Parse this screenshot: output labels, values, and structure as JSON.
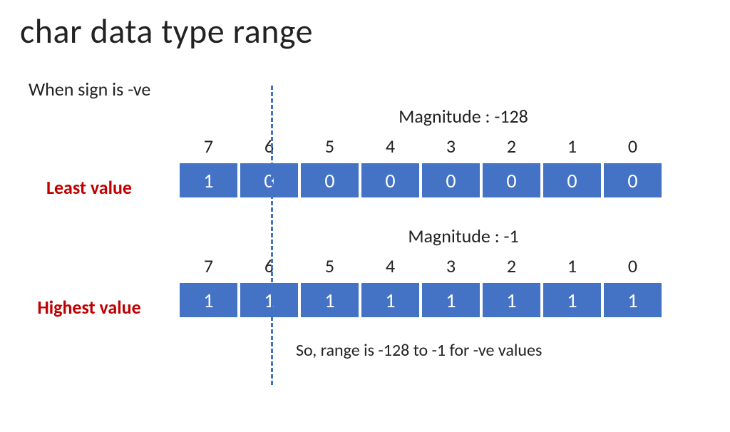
{
  "title": "char data type range",
  "subtitle": "When sign is -ve",
  "sections": [
    {
      "magnitude": "Magnitude  : -128",
      "label": "Least value",
      "indices": [
        "7",
        "6",
        "5",
        "4",
        "3",
        "2",
        "1",
        "0"
      ],
      "bits": [
        "1",
        "0",
        "0",
        "0",
        "0",
        "0",
        "0",
        "0"
      ]
    },
    {
      "magnitude": "Magnitude  : -1",
      "label": "Highest value",
      "indices": [
        "7",
        "6",
        "5",
        "4",
        "3",
        "2",
        "1",
        "0"
      ],
      "bits": [
        "1",
        "1",
        "1",
        "1",
        "1",
        "1",
        "1",
        "1"
      ]
    }
  ],
  "conclusion": "So, range is -128 to -1 for -ve values"
}
